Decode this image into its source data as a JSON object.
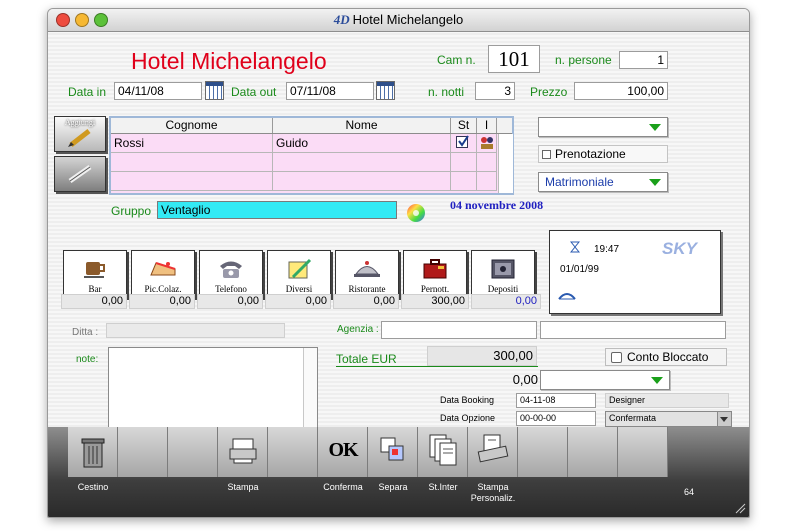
{
  "window": {
    "title": "Hotel Michelangelo",
    "logo_text": "4D"
  },
  "header": {
    "hotel_name": "Hotel Michelangelo",
    "room_label": "Cam  n.",
    "room_value": "101",
    "persons_label": "n. persone",
    "persons_value": "1",
    "date_in_label": "Data in",
    "date_in_value": "04/11/08",
    "date_out_label": "Data out",
    "date_out_value": "07/11/08",
    "nights_label": "n. notti",
    "nights_value": "3",
    "price_label": "Prezzo",
    "price_value": "100,00"
  },
  "guests": {
    "add_button_label": "Aggiungi",
    "columns": [
      "Cognome",
      "Nome",
      "St",
      "I"
    ],
    "rows": [
      {
        "cognome": "Rossi",
        "nome": "Guido",
        "st_checked": true
      }
    ]
  },
  "side": {
    "prenotazione_label": "Prenotazione",
    "room_type_value": "Matrimoniale"
  },
  "group": {
    "label": "Gruppo",
    "value": "Ventaglio"
  },
  "date_display": "04 novembre 2008",
  "services": [
    {
      "label": "Bar",
      "total": "0,00"
    },
    {
      "label": "Pic.Colaz.",
      "total": "0,00"
    },
    {
      "label": "Telefono",
      "total": "0,00"
    },
    {
      "label": "Diversi",
      "total": "0,00"
    },
    {
      "label": "Ristorante",
      "total": "0,00"
    },
    {
      "label": "Pernott.",
      "total": "300,00"
    },
    {
      "label": "Depositi",
      "total": "0,00"
    }
  ],
  "info_panel": {
    "time": "19:47",
    "date": "01/01/99",
    "logo": "SKY"
  },
  "company": {
    "ditta_label": "Ditta :",
    "agenzia_label": "Agenzia :"
  },
  "notes": {
    "label": "note:"
  },
  "totals": {
    "label": "Totale  EUR",
    "value": "300,00",
    "secondary_value": "0,00",
    "conto_bloccato_label": "Conto Bloccato"
  },
  "booking": {
    "data_booking_label": "Data Booking",
    "data_booking_value": "04-11-08",
    "designer_value": "Designer",
    "data_opzione_label": "Data Opzione",
    "data_opzione_value": "00-00-00",
    "status_value": "Confermata"
  },
  "bottom_bar": {
    "buttons": [
      {
        "label": "Cestino"
      },
      {
        "label": "Stampa"
      },
      {
        "label": "Conferma"
      },
      {
        "label": "Separa"
      },
      {
        "label": "St.Inter"
      },
      {
        "label": "Stampa\nPersonaliz."
      }
    ],
    "ok_text": "OK",
    "page_number": "64"
  },
  "colors": {
    "title_red": "#e0001a",
    "label_green": "#1a8a1a",
    "date_blue": "#2020c0",
    "grid_pink": "#fbdcf6",
    "group_cyan": "#33eaf4"
  }
}
